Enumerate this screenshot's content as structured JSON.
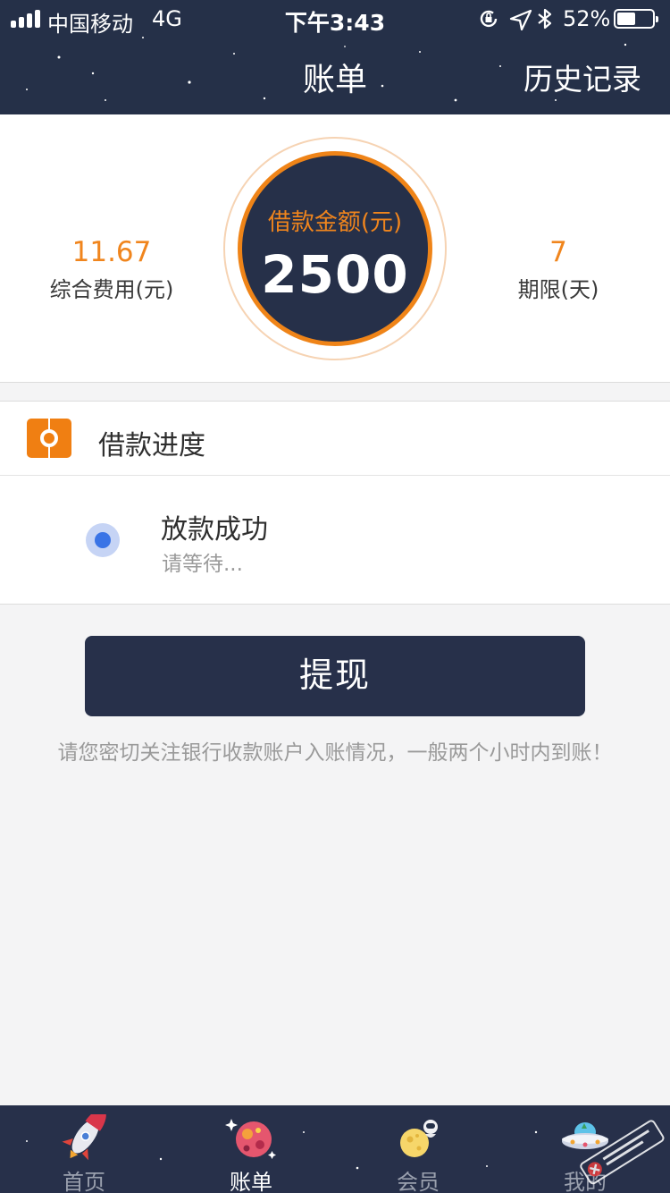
{
  "status_bar": {
    "carrier": "中国移动",
    "network": "4G",
    "time": "下午3:43",
    "battery_percent": "52%",
    "battery_level": 0.52,
    "icons": [
      "rotation-lock-icon",
      "location-arrow-icon",
      "bluetooth-icon"
    ]
  },
  "nav": {
    "title": "账单",
    "right_action": "历史记录"
  },
  "summary": {
    "left_value": "11.67",
    "left_label": "综合费用(元)",
    "center_caption": "借款金额(元)",
    "center_value": "2500",
    "right_value": "7",
    "right_label": "期限(天)"
  },
  "progress": {
    "section_title": "借款进度",
    "step_title": "放款成功",
    "step_subtitle": "请等待..."
  },
  "action": {
    "button_label": "提现",
    "notice": "请您密切关注银行收款账户入账情况，一般两个小时内到账！"
  },
  "tabbar": {
    "tabs": [
      {
        "label": "首页",
        "icon": "rocket-icon",
        "active": false
      },
      {
        "label": "账单",
        "icon": "planet-icon",
        "active": true
      },
      {
        "label": "会员",
        "icon": "moon-astronaut-icon",
        "active": false
      },
      {
        "label": "我的",
        "icon": "ufo-icon",
        "active": false
      }
    ]
  },
  "colors": {
    "header_bg": "#253048",
    "accent_orange": "#f0851d",
    "step_blue": "#3a74e6",
    "button_bg": "#27304a"
  }
}
